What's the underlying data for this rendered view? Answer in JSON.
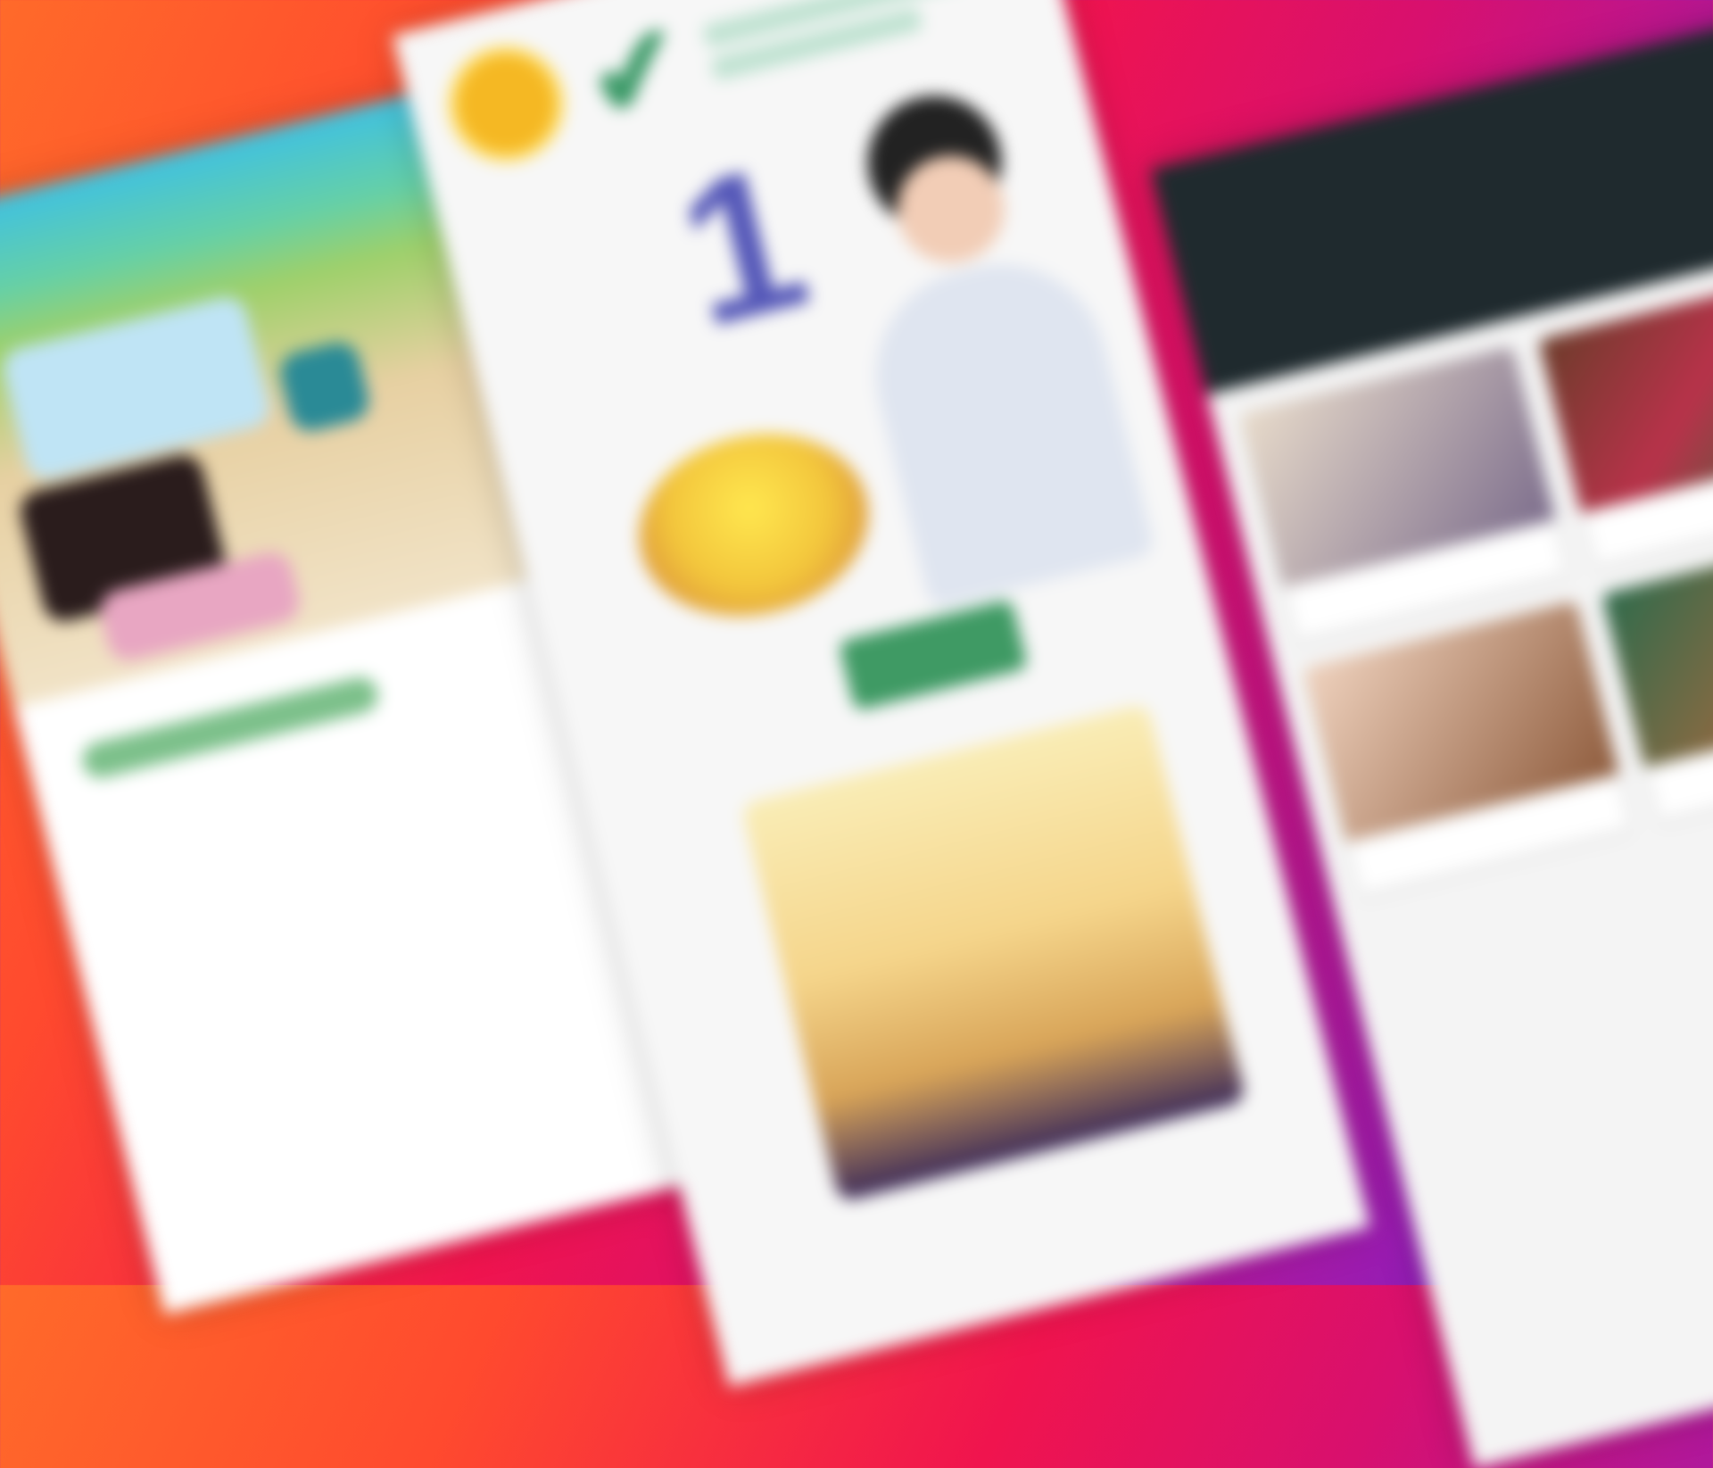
{
  "left_card": {
    "headline": "",
    "sub": "",
    "tag": ""
  },
  "middle_card": {
    "hero_number": "1",
    "hero_text": "",
    "food_caption": "",
    "cta_label": "",
    "promo_title": ""
  },
  "right_card": {
    "heading_line1": "",
    "heading_line2": "",
    "tiles": [
      {
        "label": ""
      },
      {
        "label": ""
      },
      {
        "label": ""
      },
      {
        "label": ""
      }
    ]
  },
  "colors": {
    "background_start": "#ff6a2a",
    "background_mid": "#f0144e",
    "background_end": "#6a22d8",
    "brand_green": "#3f9a64",
    "accent_purple": "#5457b8",
    "dark_header": "#1f2a2e"
  },
  "icons": [
    "check-icon",
    "badge-icon"
  ]
}
